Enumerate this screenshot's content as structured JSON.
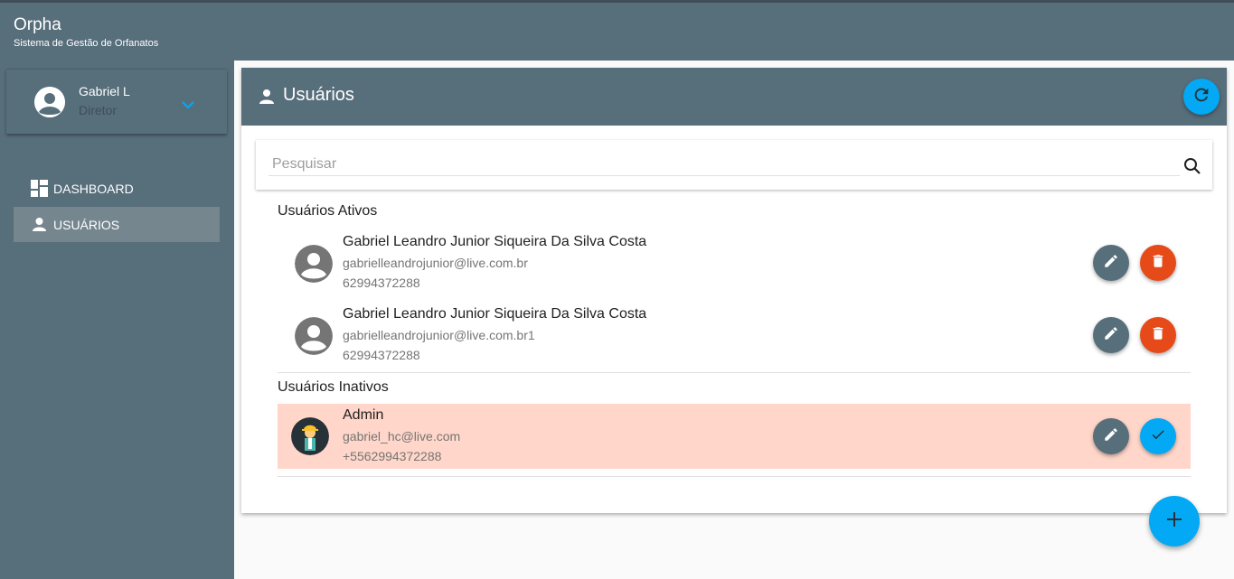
{
  "app": {
    "title": "Orpha",
    "subtitle": "Sistema de Gestão de Orfanatos"
  },
  "sidebar": {
    "user": {
      "name": "Gabriel L",
      "role": "Diretor"
    },
    "items": [
      {
        "label": "DASHBOARD",
        "icon": "dashboard-icon",
        "active": false
      },
      {
        "label": "USUÁRIOS",
        "icon": "person-icon",
        "active": true
      }
    ]
  },
  "page": {
    "title": "Usuários",
    "search": {
      "placeholder": "Pesquisar",
      "value": ""
    },
    "active_section": "Usuários Ativos",
    "inactive_section": "Usuários Inativos",
    "active_users": [
      {
        "name": "Gabriel Leandro Junior Siqueira Da Silva Costa",
        "email": "gabrielleandrojunior@live.com.br",
        "phone": "62994372288"
      },
      {
        "name": "Gabriel Leandro Junior Siqueira Da Silva Costa",
        "email": "gabrielleandrojunior@live.com.br1",
        "phone": "62994372288"
      }
    ],
    "inactive_users": [
      {
        "name": "Admin",
        "email": "gabriel_hc@live.com",
        "phone": "+5562994372288"
      }
    ]
  },
  "colors": {
    "primary": "#576e7b",
    "accent": "#03a9f4",
    "danger": "#e64a19",
    "inactive_row": "#ffd6c9"
  }
}
